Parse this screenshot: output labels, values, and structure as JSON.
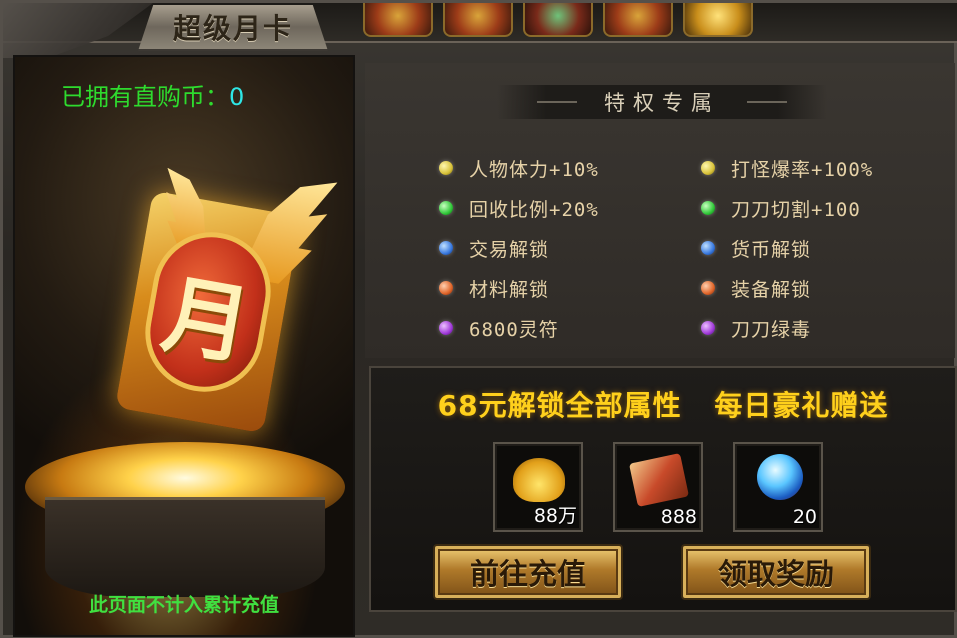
{
  "window": {
    "title": "超级月卡"
  },
  "coins": {
    "label": "已拥有直购币：",
    "value": "0"
  },
  "card": {
    "glyph": "月"
  },
  "left_footer": "此页面不计入累计充值",
  "privileges": {
    "header": "特权专属",
    "left": [
      {
        "label": "人物体力+10%",
        "gem_color": "#d8c23a"
      },
      {
        "label": "回收比例+20%",
        "gem_color": "#32c83a"
      },
      {
        "label": "交易解锁",
        "gem_color": "#3a7ae0"
      },
      {
        "label": "材料解锁",
        "gem_color": "#e0662a"
      },
      {
        "label": "6800灵符",
        "gem_color": "#a03ad8"
      }
    ],
    "right": [
      {
        "label": "打怪爆率+100%",
        "gem_color": "#d8c23a"
      },
      {
        "label": "刀刀切割+100",
        "gem_color": "#32c83a"
      },
      {
        "label": "货币解锁",
        "gem_color": "#3a7ae0"
      },
      {
        "label": "装备解锁",
        "gem_color": "#e0662a"
      },
      {
        "label": "刀刀绿毒",
        "gem_color": "#a03ad8"
      }
    ]
  },
  "rewards": {
    "title": "68元解锁全部属性 每日豪礼赠送",
    "items": [
      {
        "icon": "gold-ingot-icon",
        "count": "88万"
      },
      {
        "icon": "scroll-icon",
        "count": "888"
      },
      {
        "icon": "crystal-orb-icon",
        "count": "20"
      }
    ]
  },
  "buttons": {
    "recharge": "前往充值",
    "claim": "领取奖励"
  }
}
